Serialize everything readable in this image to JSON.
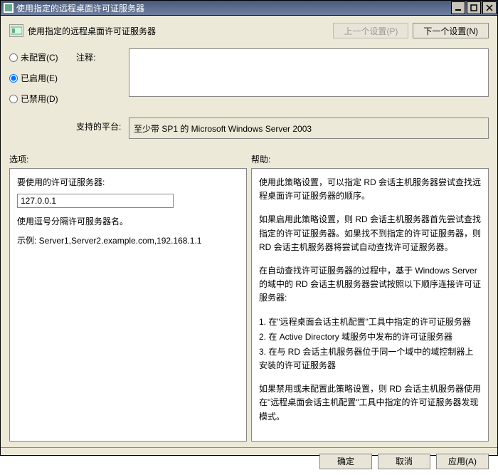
{
  "window": {
    "title": "使用指定的远程桌面许可证服务器"
  },
  "header": {
    "subtitle": "使用指定的远程桌面许可证服务器",
    "prev_btn": "上一个设置(P)",
    "next_btn": "下一个设置(N)"
  },
  "radios": {
    "unconfigured": "未配置(C)",
    "enabled": "已启用(E)",
    "disabled": "已禁用(D)"
  },
  "labels": {
    "comment": "注释:",
    "platform": "支持的平台:",
    "options": "选项:",
    "help": "帮助:"
  },
  "comment_value": "",
  "platform_value": "至少带 SP1 的 Microsoft Windows Server 2003",
  "options_panel": {
    "field_label": "要使用的许可证服务器:",
    "field_value": "127.0.0.1",
    "note1": "使用逗号分隔许可服务器名。",
    "note2": "示例: Server1,Server2.example.com,192.168.1.1"
  },
  "help_panel": {
    "p1": "使用此策略设置，可以指定 RD 会话主机服务器尝试查找远程桌面许可证服务器的顺序。",
    "p2": "如果启用此策略设置，则 RD 会话主机服务器首先尝试查找指定的许可证服务器。如果找不到指定的许可证服务器，则 RD 会话主机服务器将尝试自动查找许可证服务器。",
    "p3": "在自动查找许可证服务器的过程中，基于 Windows Server 的域中的 RD 会话主机服务器尝试按照以下顺序连接许可证服务器:",
    "p4": "1. 在\"远程桌面会话主机配置\"工具中指定的许可证服务器",
    "p5": "2. 在 Active Directory 域服务中发布的许可证服务器",
    "p6": "3. 在与 RD 会话主机服务器位于同一个域中的域控制器上安装的许可证服务器",
    "p7": "如果禁用或未配置此策略设置，则 RD 会话主机服务器使用在\"远程桌面会话主机配置\"工具中指定的许可证服务器发现模式。"
  },
  "footer": {
    "ok": "确定",
    "cancel": "取消",
    "apply": "应用(A)"
  }
}
